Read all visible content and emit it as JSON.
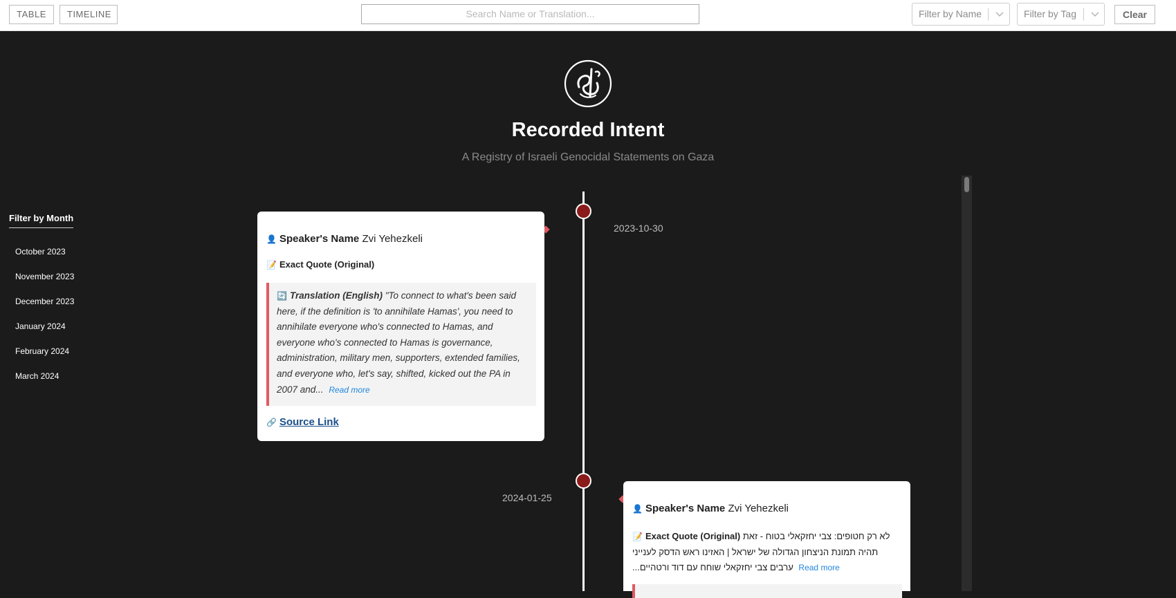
{
  "topbar": {
    "view_buttons": [
      "TABLE",
      "TIMELINE"
    ],
    "search_placeholder": "Search Name or Translation...",
    "filter_name_placeholder": "Filter by Name",
    "filter_tag_placeholder": "Filter by Tag",
    "clear_label": "Clear"
  },
  "header": {
    "title": "Recorded Intent",
    "subtitle": "A Registry of Israeli Genocidal Statements on Gaza"
  },
  "month_filter": {
    "heading": "Filter by Month",
    "months": [
      "October 2023",
      "November 2023",
      "December 2023",
      "January 2024",
      "February 2024",
      "March 2024"
    ]
  },
  "entries": [
    {
      "date": "2023-10-30",
      "speaker_label": "Speaker's Name",
      "speaker_name": "Zvi Yehezkeli",
      "quote_label": "Exact Quote (Original)",
      "quote_text": "",
      "translation_label": "Translation (English)",
      "translation_text": "\"To connect to what's been said here, if the definition is 'to annihilate Hamas', you need to annihilate everyone who's connected to Hamas, and everyone who's connected to Hamas is governance, administration, military men, supporters, extended families, and everyone who, let's say, shifted, kicked out the PA in 2007 and...",
      "read_more": "Read more",
      "source_label": "Source Link"
    },
    {
      "date": "2024-01-25",
      "speaker_label": "Speaker's Name",
      "speaker_name": "Zvi Yehezkeli",
      "quote_label": "Exact Quote (Original)",
      "quote_line1": "לא רק חטופים: צבי יחזקאלי בטוח - זאת",
      "quote_line2": "תהיה תמונת הניצחון הגדולה של ישראל | האזינו ראש הדסק לענייני",
      "quote_line3": "ערבים צבי יחזקאלי שוחח עם דוד ורטהיים...",
      "read_more": "Read more"
    }
  ],
  "colors": {
    "background": "#1b1b1b",
    "accent_red": "#e05a63",
    "dot_red": "#8b1a1a",
    "link_blue": "#1f86de"
  }
}
